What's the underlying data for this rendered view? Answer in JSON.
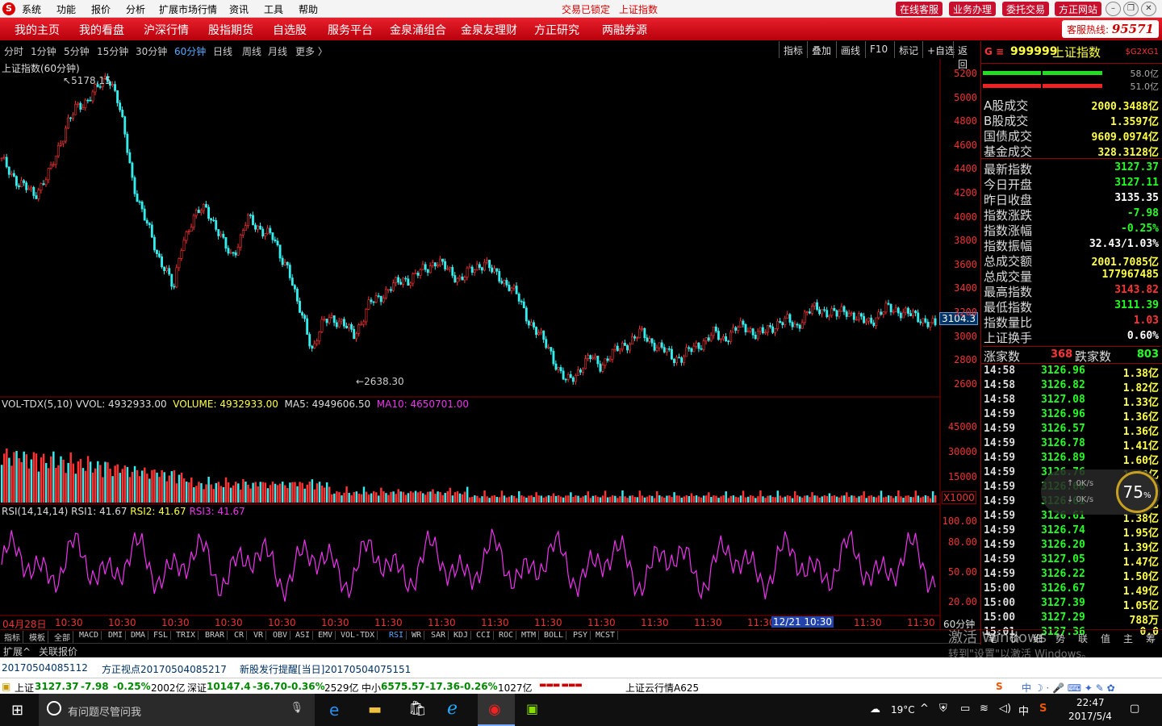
{
  "menu": {
    "items": [
      "系统",
      "功能",
      "报价",
      "分析",
      "扩展市场行情",
      "资讯",
      "工具",
      "帮助"
    ],
    "status1": "交易已锁定",
    "status2": "上证指数",
    "buttons": [
      "在线客服",
      "业务办理",
      "委托交易",
      "方正网站"
    ]
  },
  "nav": {
    "items": [
      "我的主页",
      "我的看盘",
      "沪深行情",
      "股指期货",
      "自选股",
      "服务平台",
      "金泉涌组合",
      "金泉友理财",
      "方正研究",
      "两融券源"
    ],
    "hotline_label": "客服热线:",
    "hotline": "95571"
  },
  "periods": {
    "items": [
      "分时",
      "1分钟",
      "5分钟",
      "15分钟",
      "30分钟",
      "60分钟",
      "日线",
      "周线",
      "月线",
      "更多 〉"
    ],
    "active": 5,
    "tools": [
      "指标",
      "叠加",
      "画线",
      "F10",
      "标记",
      "+自选",
      "返回"
    ]
  },
  "main": {
    "title": "上证指数(60分钟)",
    "high_label": "5178.15",
    "low_label": "2638.30",
    "current_tag": "3104.3",
    "yaxis": [
      "5200",
      "5000",
      "4800",
      "4600",
      "4400",
      "4200",
      "4000",
      "3800",
      "3600",
      "3400",
      "3200",
      "3000",
      "2800",
      "2600"
    ]
  },
  "vol": {
    "name": "VOL-TDX(5,10)",
    "vvol": "VVOL: 4932933.00",
    "volume": "VOLUME: 4932933.00",
    "ma5": "MA5: 4949606.50",
    "ma10": "MA10: 4650701.00",
    "yaxis": [
      "45000",
      "30000",
      "15000"
    ],
    "unit": "X1000"
  },
  "rsi": {
    "name": "RSI(14,14,14)",
    "rsi1": "RSI1: 41.67",
    "rsi2": "RSI2: 41.67",
    "rsi3": "RSI3: 41.67",
    "yaxis": [
      "100.00",
      "80.00",
      "50.00",
      "20.00"
    ]
  },
  "xaxis": {
    "start": "04月28日",
    "labels": [
      "10:30",
      "10:30",
      "10:30",
      "10:30",
      "10:30",
      "10:30",
      "11:30",
      "11:30",
      "11:30",
      "11:30",
      "11:30",
      "11:30",
      "11:30",
      "11:30",
      "11:30",
      "11:30"
    ],
    "highlight": "12/21 10:30",
    "period": "60分钟"
  },
  "tabs": [
    "指标",
    "模板",
    "全部",
    "MACD",
    "DMI",
    "DMA",
    "FSL",
    "TRIX",
    "BRAR",
    "CR",
    "VR",
    "OBV",
    "ASI",
    "EMV",
    "VOL-TDX",
    "RSI",
    "WR",
    "SAR",
    "KDJ",
    "CCI",
    "ROC",
    "MTM",
    "BOLL",
    "PSY",
    "MCST"
  ],
  "subbar": [
    "扩展^",
    "关联报价"
  ],
  "panel": {
    "code": "999999",
    "name": "上证指数",
    "badge": "$G2XG1",
    "pct_top": "58.0亿",
    "pct_bot": "51.0亿",
    "turnover": [
      {
        "label": "A股成交",
        "value": "2000.3488亿"
      },
      {
        "label": "B股成交",
        "value": "1.3597亿"
      },
      {
        "label": "国债成交",
        "value": "9609.0974亿"
      },
      {
        "label": "基金成交",
        "value": "328.3128亿"
      }
    ],
    "stats": [
      {
        "label": "最新指数",
        "value": "3127.37",
        "c": "g"
      },
      {
        "label": "今日开盘",
        "value": "3127.11",
        "c": "g"
      },
      {
        "label": "昨日收盘",
        "value": "3135.35",
        "c": "w"
      },
      {
        "label": "指数涨跌",
        "value": "-7.98",
        "c": "g"
      },
      {
        "label": "指数涨幅",
        "value": "-0.25%",
        "c": "g"
      },
      {
        "label": "指数振幅",
        "value": "32.43/1.03%",
        "c": "w"
      },
      {
        "label": "总成交额",
        "value": "2001.7085亿",
        "c": "y"
      },
      {
        "label": "总成交量",
        "value": "177967485",
        "c": "y"
      },
      {
        "label": "最高指数",
        "value": "3143.82",
        "c": "r"
      },
      {
        "label": "最低指数",
        "value": "3111.39",
        "c": "g"
      },
      {
        "label": "指数量比",
        "value": "1.03",
        "c": "r"
      },
      {
        "label": "上证换手",
        "value": "0.60%",
        "c": "w"
      }
    ],
    "updown": {
      "up_label": "涨家数",
      "up": "368",
      "down_label": "跌家数",
      "down": "803"
    },
    "ticks": [
      [
        "14:58",
        "3126.96",
        "1.38亿"
      ],
      [
        "14:58",
        "3126.82",
        "1.82亿"
      ],
      [
        "14:58",
        "3127.08",
        "1.33亿"
      ],
      [
        "14:59",
        "3126.96",
        "1.36亿"
      ],
      [
        "14:59",
        "3126.57",
        "1.36亿"
      ],
      [
        "14:59",
        "3126.78",
        "1.41亿"
      ],
      [
        "14:59",
        "3126.89",
        "1.60亿"
      ],
      [
        "14:59",
        "3126.76",
        "1.6?亿"
      ],
      [
        "14:59",
        "3126.66",
        "1.??亿"
      ],
      [
        "14:59",
        "3126.61",
        "1.??亿"
      ],
      [
        "14:59",
        "3126.61",
        "1.38亿"
      ],
      [
        "14:59",
        "3126.74",
        "1.95亿"
      ],
      [
        "14:59",
        "3126.20",
        "1.39亿"
      ],
      [
        "14:59",
        "3127.05",
        "1.47亿"
      ],
      [
        "14:59",
        "3126.22",
        "1.50亿"
      ],
      [
        "15:00",
        "3126.67",
        "1.49亿"
      ],
      [
        "15:00",
        "3127.39",
        "1.05亿"
      ],
      [
        "15:00",
        "3127.29",
        "788万"
      ],
      [
        "15:01",
        "3127.36",
        "0.0"
      ]
    ],
    "bottom_tabs": [
      "笔",
      "价",
      "细",
      "势",
      "联",
      "值",
      "主",
      "筹"
    ]
  },
  "news": [
    "20170504085112",
    "方正视点20170504085217",
    "新股发行提醒[当日]20170504075151"
  ],
  "index": [
    {
      "name": "上证",
      "value": "3127.37",
      "chg": "-7.98",
      "pct": "-0.25%",
      "amt": "2002亿"
    },
    {
      "name": "深证",
      "value": "10147.4",
      "chg": "-36.70",
      "pct": "-0.36%",
      "amt": "2529亿"
    },
    {
      "name": "中小",
      "value": "6575.57",
      "chg": "-17.36",
      "pct": "-0.26%",
      "amt": "1027亿"
    }
  ],
  "ticker_extra": "上证云行情A625",
  "speed": {
    "pct": "75",
    "up": "0K/s",
    "down": "0K/s"
  },
  "watermark": [
    "激活 Windows",
    "转到\"设置\"以激活 Windows。"
  ],
  "taskbar": {
    "search": "有问题尽管问我",
    "weather": "19°C",
    "ime": "中",
    "time": "22:47",
    "date": "2017/5/4"
  },
  "chart_data": {
    "type": "candlestick",
    "series": [
      {
        "name": "上证指数",
        "x_start": "04月28日",
        "ylim": [
          2550,
          5300
        ],
        "close": [
          4480,
          4400,
          4300,
          4250,
          4200,
          4300,
          4400,
          4600,
          4800,
          4900,
          4950,
          5050,
          5100,
          5178,
          5050,
          4700,
          4300,
          4100,
          3900,
          3700,
          3600,
          3400,
          3800,
          3950,
          4050,
          4100,
          3950,
          3800,
          3700,
          3800,
          4000,
          3950,
          3900,
          3850,
          3700,
          3600,
          3300,
          3150,
          2900,
          3100,
          3200,
          3150,
          3100,
          3050,
          3150,
          3300,
          3350,
          3400,
          3450,
          3500,
          3500,
          3550,
          3600,
          3650,
          3600,
          3550,
          3500,
          3550,
          3600,
          3650,
          3550,
          3500,
          3450,
          3350,
          3200,
          3100,
          3000,
          2900,
          2750,
          2640,
          2700,
          2800,
          2850,
          2780,
          2850,
          2900,
          2950,
          3000,
          3050,
          3000,
          2950,
          2900,
          2850,
          2850,
          2900,
          2950,
          3000,
          3050,
          3000,
          3050,
          3100,
          3100,
          3050,
          3050,
          3100,
          3150,
          3150,
          3100,
          3200,
          3250,
          3250,
          3230,
          3200,
          3250,
          3200,
          3150,
          3150,
          3200,
          3250,
          3250,
          3230,
          3200,
          3180,
          3150,
          3104
        ]
      },
      {
        "name": "VOL-TDX",
        "unit": "X1000",
        "ylim": [
          0,
          55000
        ]
      },
      {
        "name": "RSI1",
        "ylim": [
          0,
          100
        ]
      }
    ]
  }
}
